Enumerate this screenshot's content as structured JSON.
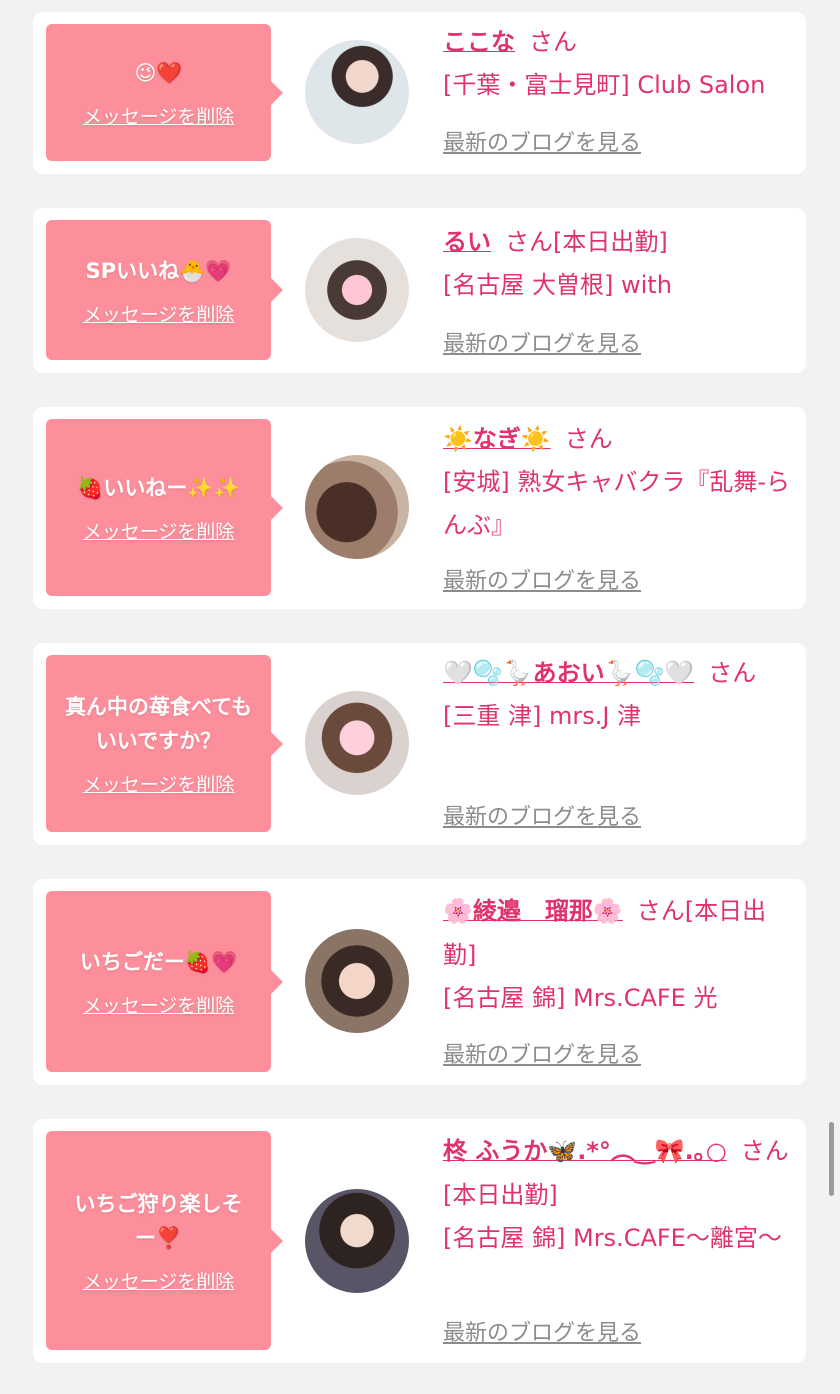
{
  "common": {
    "delete_label": "メッセージを削除",
    "blog_label": "最新のブログを見る"
  },
  "items": [
    {
      "message": "😉❤️",
      "name": "ここな",
      "suffix": "さん",
      "shop": "[千葉・富士見町] Club Salon"
    },
    {
      "message": "SPいいね🐣💗",
      "name": "るい",
      "suffix": "さん[本日出勤]",
      "shop": "[名古屋 大曽根] with"
    },
    {
      "message": "🍓いいねー✨✨",
      "name": "☀️なぎ☀️",
      "suffix": "さん",
      "shop": "[安城] 熟女キャバクラ『乱舞-らんぶ』"
    },
    {
      "message": "真ん中の苺食べてもいいですか？",
      "name": "🤍🫧🪿あおい🪿🫧🤍",
      "suffix": "さん",
      "shop": "[三重 津] mrs.J 津"
    },
    {
      "message": "いちごだー🍓💗",
      "name": "🌸綾邉　瑠那🌸",
      "suffix": "さん[本日出勤]",
      "shop": "[名古屋 錦] Mrs.CAFE 光"
    },
    {
      "message": "いちご狩り楽しそー❣️",
      "name": "柊 ふうか🦋.*°︵‿🎀.｡○",
      "suffix": "さん[本日出勤]",
      "shop": "[名古屋 錦] Mrs.CAFE〜離宮〜"
    }
  ],
  "colors": {
    "bubble": "#fc8f9b",
    "accent": "#e0336e",
    "link_gray": "#8c8c8c",
    "background": "#f2f2f2"
  }
}
